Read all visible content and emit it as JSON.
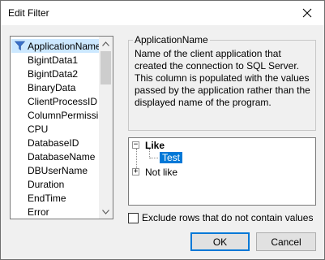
{
  "window": {
    "title": "Edit Filter"
  },
  "columns": {
    "items": [
      {
        "label": "ApplicationName",
        "selected": true
      },
      {
        "label": "BigintData1"
      },
      {
        "label": "BigintData2"
      },
      {
        "label": "BinaryData"
      },
      {
        "label": "ClientProcessID"
      },
      {
        "label": "ColumnPermissi..."
      },
      {
        "label": "CPU"
      },
      {
        "label": "DatabaseID"
      },
      {
        "label": "DatabaseName"
      },
      {
        "label": "DBUserName"
      },
      {
        "label": "Duration"
      },
      {
        "label": "EndTime"
      },
      {
        "label": "Error"
      }
    ]
  },
  "detail": {
    "group_title": "ApplicationName",
    "description": "Name of the client application that created the connection to SQL Server. This column is populated with the values passed by the application rather than the displayed name of the program."
  },
  "tree": {
    "nodes": [
      {
        "label": "Like",
        "expanded": true,
        "children": [
          {
            "label": "Test",
            "selected": true
          }
        ]
      },
      {
        "label": "Not like",
        "expanded": false
      }
    ]
  },
  "options": {
    "exclude_label": "Exclude rows that do not contain values",
    "exclude_checked": false
  },
  "buttons": {
    "ok": "OK",
    "cancel": "Cancel"
  },
  "colors": {
    "selection_light": "#cce8ff",
    "selection": "#0078d7",
    "filter_icon": "#3a70c9"
  },
  "icons": {
    "close": "close-icon",
    "filter": "filter-icon",
    "scroll_up": "scroll-up-arrow-icon",
    "scroll_down": "scroll-down-arrow-icon"
  }
}
